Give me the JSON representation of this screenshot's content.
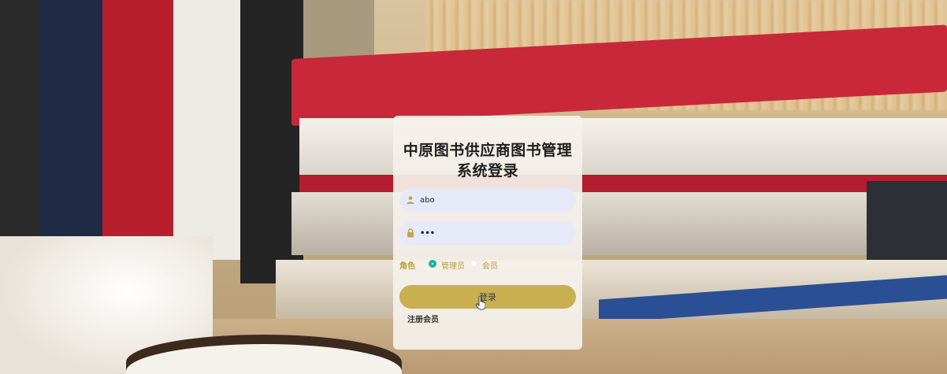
{
  "login": {
    "title_line1": "中原图书供应商图书管理",
    "title_line2": "系统登录",
    "username_value": "abo",
    "password_value": "•••",
    "role_label": "角色",
    "role_options": [
      "管理员",
      "会员"
    ],
    "role_selected": "管理员",
    "login_button": "登录",
    "register_link": "注册会员"
  },
  "colors": {
    "accent": "#c8b050",
    "radio_selected": "#18b69b",
    "input_bg": "#e6eaf8",
    "role_text": "#b89e34"
  },
  "icons": {
    "username": "user-icon",
    "password": "lock-icon"
  }
}
